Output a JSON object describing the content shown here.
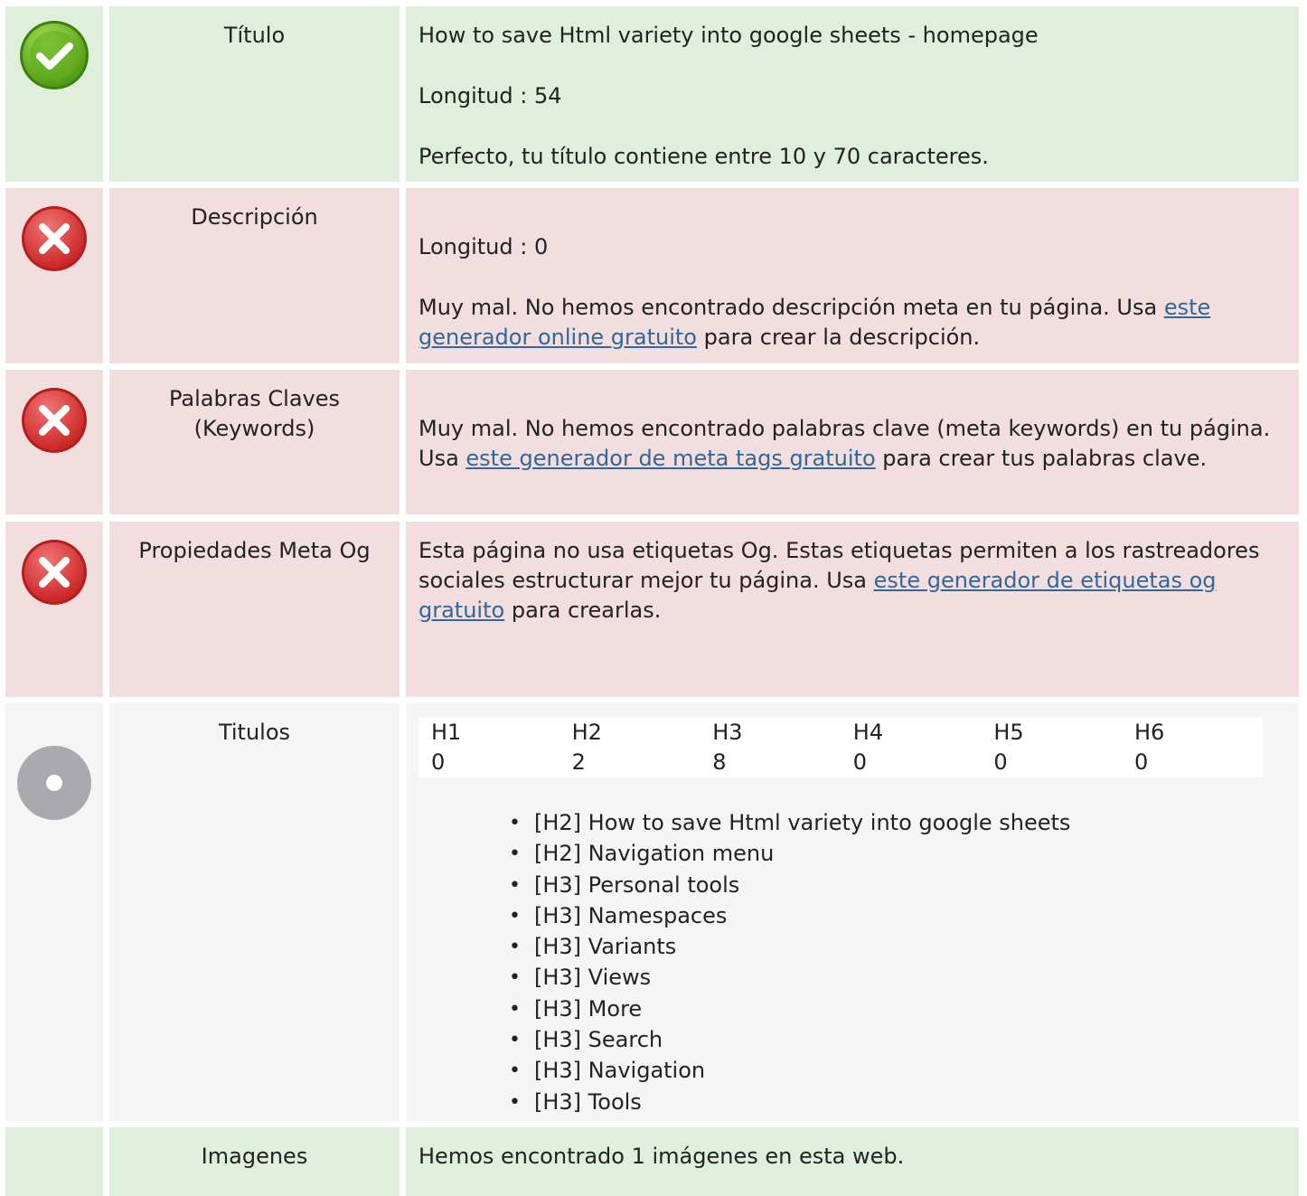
{
  "titulo": {
    "label": "Título",
    "title_text": "How to save Html variety into google sheets - homepage",
    "length_text": "Longitud : 54",
    "message": "Perfecto, tu título contiene entre 10 y 70 caracteres."
  },
  "descripcion": {
    "label": "Descripción",
    "length_text": "Longitud : 0",
    "message_before": "Muy mal. No hemos encontrado descripción meta en tu página. Usa ",
    "link_text": "este generador online gratuito",
    "message_after": " para crear la descripción."
  },
  "keywords": {
    "label_line1": "Palabras Claves",
    "label_line2": "(Keywords)",
    "message_before": "Muy mal. No hemos encontrado palabras clave (meta keywords) en tu página. Usa ",
    "link_text": "este generador de meta tags gratuito",
    "message_after": " para crear tus palabras clave."
  },
  "og": {
    "label": "Propiedades Meta Og",
    "message_before": "Esta página no usa etiquetas Og. Estas etiquetas permiten a los rastreadores sociales estructurar mejor tu página. Usa ",
    "link_text": "este generador de etiquetas og gratuito",
    "message_after": " para crearlas."
  },
  "titulos": {
    "label": "Titulos",
    "headers": [
      "H1",
      "H2",
      "H3",
      "H4",
      "H5",
      "H6"
    ],
    "counts": [
      "0",
      "2",
      "8",
      "0",
      "0",
      "0"
    ],
    "items": [
      "[H2] How to save Html variety into google sheets",
      "[H2] Navigation menu",
      "[H3] Personal tools",
      "[H3] Namespaces",
      "[H3] Variants",
      "[H3] Views",
      "[H3] More",
      "[H3] Search",
      "[H3] Navigation",
      "[H3] Tools"
    ]
  },
  "imagenes": {
    "label": "Imagenes",
    "message": "Hemos encontrado 1 imágenes en esta web."
  },
  "icons": {
    "ok": "check-circle-icon",
    "bad": "x-circle-icon",
    "neutral": "info-dot-icon"
  },
  "colors": {
    "ok_bg": "#dfefdb",
    "bad_bg": "#f2dedf",
    "neutral_bg": "#f5f5f5",
    "link": "#336699"
  }
}
